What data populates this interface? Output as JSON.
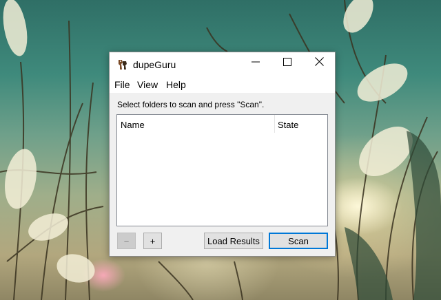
{
  "window": {
    "title": "dupeGuru"
  },
  "menu": {
    "items": [
      "File",
      "View",
      "Help"
    ]
  },
  "main": {
    "instruction": "Select folders to scan and press \"Scan\".",
    "columns": [
      "Name",
      "State"
    ]
  },
  "buttons": {
    "remove_label": "−",
    "add_label": "+",
    "load_results_label": "Load Results",
    "scan_label": "Scan"
  },
  "icons": {
    "app": "dupeguru-app-icon",
    "minimize": "minimize-icon",
    "maximize": "maximize-icon",
    "close": "close-icon"
  },
  "colors": {
    "accent": "#0078d7",
    "window_bg": "#f0f0f0",
    "titlebar_bg": "#ffffff"
  }
}
